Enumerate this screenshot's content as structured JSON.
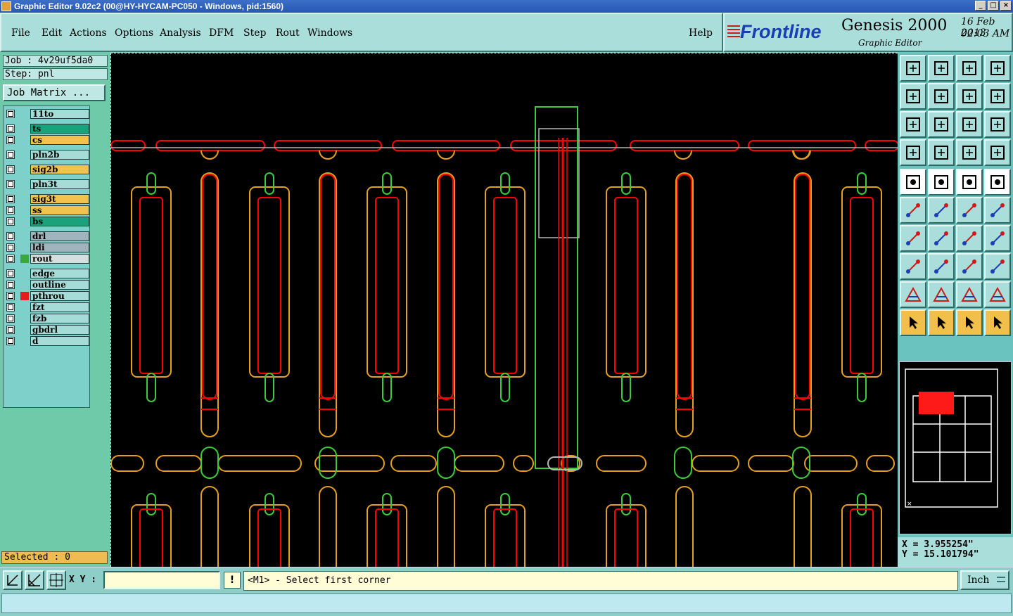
{
  "window": {
    "title": "Graphic Editor 9.02c2 (00@HY-HYCAM-PC050 - Windows, pid:1560)",
    "buttons": [
      "_",
      "□",
      "×"
    ]
  },
  "menu": [
    "File",
    "Edit",
    "Actions",
    "Options",
    "Analysis",
    "DFM",
    "Step",
    "Rout",
    "Windows"
  ],
  "help_label": "Help",
  "brand": {
    "logo": "Frontline",
    "product": "Genesis 2000",
    "subtitle": "Graphic Editor",
    "date": "16 Feb 2013",
    "time": "02:03 AM"
  },
  "job": {
    "job_label": "Job : 4v29uf5da0",
    "step_label": "Step: pnl",
    "matrix_button": "Job Matrix ..."
  },
  "layers": [
    {
      "name": "11to",
      "color": "#a6dcd7",
      "swatch": ""
    },
    {
      "name": "ts",
      "color": "#1aa37a",
      "swatch": ""
    },
    {
      "name": "cs",
      "color": "#f2c24e",
      "swatch": ""
    },
    {
      "name": "pln2b",
      "color": "#a6dcd7",
      "swatch": ""
    },
    {
      "name": "sig2b",
      "color": "#f2c24e",
      "swatch": ""
    },
    {
      "name": "pln3t",
      "color": "#a6dcd7",
      "swatch": ""
    },
    {
      "name": "sig3t",
      "color": "#f2c24e",
      "swatch": ""
    },
    {
      "name": "ss",
      "color": "#f2c24e",
      "swatch": ""
    },
    {
      "name": "bs",
      "color": "#1aa37a",
      "swatch": ""
    },
    {
      "name": "drl",
      "color": "#9fb5bb",
      "swatch": ""
    },
    {
      "name": "ldi",
      "color": "#9fb5bb",
      "swatch": ""
    },
    {
      "name": "rout",
      "color": "#d6dfe0",
      "swatch": "#3aa83a"
    },
    {
      "name": "edge",
      "color": "#a6dcd7",
      "swatch": ""
    },
    {
      "name": "outline",
      "color": "#a6dcd7",
      "swatch": ""
    },
    {
      "name": "pthrou",
      "color": "#a6dcd7",
      "swatch": "#e31d1d"
    },
    {
      "name": "fzt",
      "color": "#a6dcd7",
      "swatch": ""
    },
    {
      "name": "fzb",
      "color": "#a6dcd7",
      "swatch": ""
    },
    {
      "name": "gbdrl",
      "color": "#a6dcd7",
      "swatch": ""
    },
    {
      "name": "d",
      "color": "#a6dcd7",
      "swatch": ""
    }
  ],
  "selected_label": "Selected : 0",
  "toolbar_right": {
    "row1": [
      "open-step-icon",
      "save-icon",
      "home-icon",
      "split-view-icon"
    ],
    "row2": [
      "import-icon",
      "export-icon",
      "undo-icon",
      "snake-icon"
    ],
    "row3": [
      "zoom-fit-icon",
      "zoom-center-icon",
      "scale-icon",
      "help-icon"
    ],
    "row4": [
      "measure-icon",
      "grid-icon",
      "layer-a-icon",
      "layer-b-icon"
    ],
    "row5": [
      "camera-icon",
      "shape-icon",
      "ruler-icon",
      "select-dot-icon"
    ],
    "row6": [
      "connect-icon",
      "cross-icon",
      "move-point-icon",
      "pin-icon"
    ],
    "row7": [
      "angle-icon",
      "line-icon",
      "arc-icon",
      "flip-icon"
    ],
    "row8": [
      "pad-icon",
      "minus-icon",
      "dimension-icon",
      "cluster-icon"
    ],
    "row9": [
      "triangle-a-icon",
      "triangle-b-icon",
      "triangle-c-icon",
      "triangle-d-icon"
    ],
    "row10": [
      "pointer-icon",
      "pointer-box-icon",
      "pointer-orange-icon",
      "route-icon"
    ]
  },
  "coords": {
    "x": "X = 3.955254\"",
    "y": "Y = 15.101794\""
  },
  "bottom": {
    "xy_label": "X Y :",
    "xy_value": "",
    "excl": "!",
    "prompt": "<M1> - Select first corner",
    "units": "Inch"
  },
  "colors": {
    "red": "#ff0000",
    "orange": "#e6a01f",
    "green": "#3acb3a",
    "gray": "#b5b5b5"
  }
}
